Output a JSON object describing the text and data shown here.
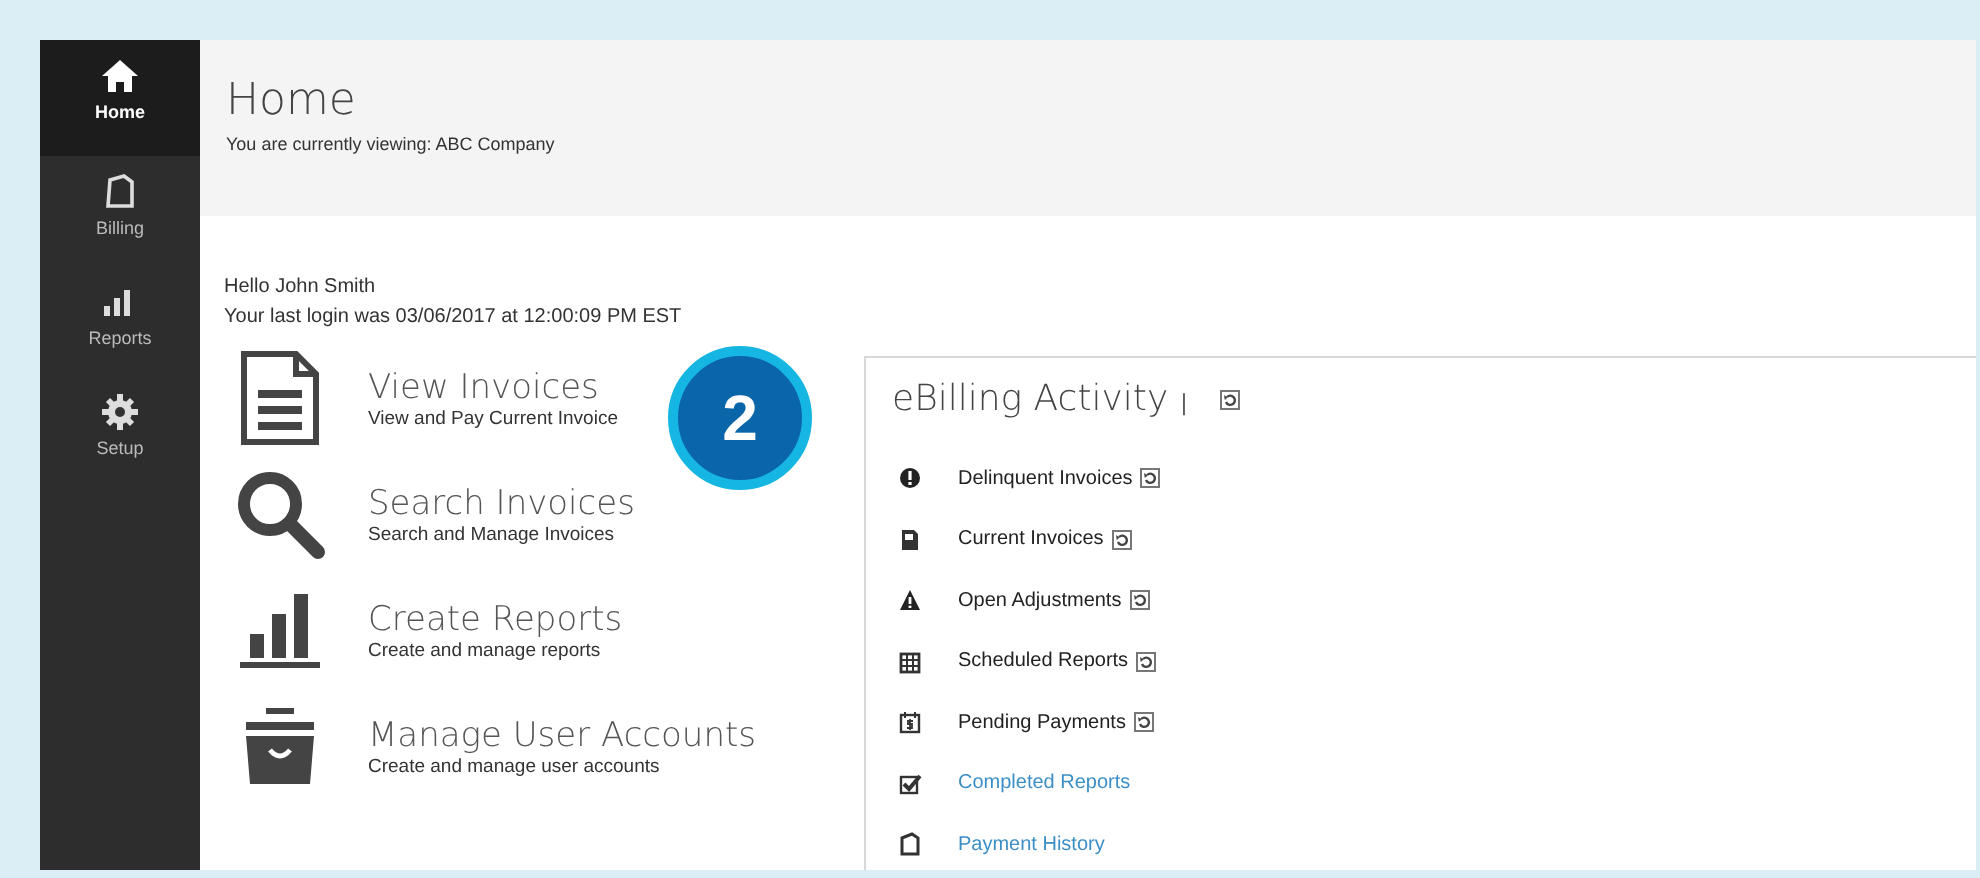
{
  "sidebar": {
    "items": [
      {
        "label": "Home",
        "selected": true
      },
      {
        "label": "Billing",
        "selected": false
      },
      {
        "label": "Reports",
        "selected": false
      },
      {
        "label": "Setup",
        "selected": false
      }
    ]
  },
  "header": {
    "title": "Home",
    "subtitle": "You are currently viewing: ABC Company"
  },
  "greeting": {
    "hello": "Hello John Smith",
    "last_login": "Your last login was 03/06/2017 at 12:00:09 PM EST"
  },
  "actions": [
    {
      "title": "View Invoices",
      "subtitle": "View and Pay Current Invoice"
    },
    {
      "title": "Search Invoices",
      "subtitle": "Search and Manage Invoices"
    },
    {
      "title": "Create Reports",
      "subtitle": "Create and manage reports"
    },
    {
      "title": "Manage User Accounts",
      "subtitle": "Create and manage user accounts"
    }
  ],
  "step_badge": "2",
  "activity": {
    "title": "eBilling Activity",
    "separator": "|",
    "items": [
      {
        "label": "Delinquent Invoices",
        "kind": "status"
      },
      {
        "label": "Current Invoices",
        "kind": "status"
      },
      {
        "label": "Open Adjustments",
        "kind": "status"
      },
      {
        "label": "Scheduled Reports",
        "kind": "status"
      },
      {
        "label": "Pending Payments",
        "kind": "status"
      },
      {
        "label": "Completed Reports",
        "kind": "link"
      },
      {
        "label": "Payment History",
        "kind": "link"
      }
    ]
  }
}
